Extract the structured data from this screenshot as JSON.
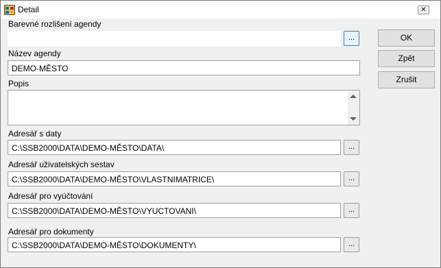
{
  "window": {
    "title": "Detail",
    "close_symbol": "✕"
  },
  "fields": {
    "color": {
      "label": "Barevné rozlišení agendy",
      "value": ""
    },
    "name": {
      "label": "Název agendy",
      "value": "DEMO-MĚSTO"
    },
    "description": {
      "label": "Popis",
      "value": ""
    },
    "data_dir": {
      "label": "Adresář s daty",
      "value": "C:\\SSB2000\\DATA\\DEMO-MĚSTO\\DATA\\"
    },
    "reports_dir": {
      "label": "Adresář uživatelských sestav",
      "value": "C:\\SSB2000\\DATA\\DEMO-MĚSTO\\VLASTNIMATRICE\\"
    },
    "billing_dir": {
      "label": "Adresář pro vyúčtování",
      "value": "C:\\SSB2000\\DATA\\DEMO-MĚSTO\\VYUCTOVANI\\"
    },
    "documents_dir": {
      "label": "Adresář pro dokumenty",
      "value": "C:\\SSB2000\\DATA\\DEMO-MĚSTO\\DOKUMENTY\\"
    }
  },
  "browse_label": "...",
  "buttons": {
    "ok": "OK",
    "back": "Zpět",
    "cancel": "Zrušit"
  },
  "icons": {
    "app": "app-icon",
    "close": "close-icon",
    "scroll_up": "scroll-up-icon",
    "scroll_down": "scroll-down-icon"
  }
}
